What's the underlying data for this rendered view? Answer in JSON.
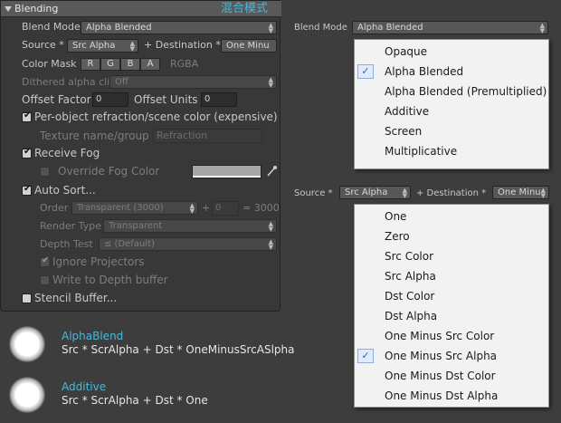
{
  "panel": {
    "title": "Blending",
    "chinese_title": "混合模式",
    "blend_mode": {
      "label": "Blend Mode",
      "value": "Alpha Blended"
    },
    "source": {
      "label": "Source *",
      "value": "Src Alpha"
    },
    "destination": {
      "label": "+ Destination *",
      "value": "One Minu"
    },
    "color_mask": {
      "label": "Color Mask",
      "channels": [
        "R",
        "G",
        "B",
        "A"
      ],
      "display": "RGBA"
    },
    "dithered": {
      "label": "Dithered alpha clip",
      "value": "Off"
    },
    "offset_factor": {
      "label": "Offset Factor",
      "value": "0"
    },
    "offset_units": {
      "label": "Offset Units",
      "value": "0"
    },
    "per_object_refraction": {
      "label": "Per-object refraction/scene color (expensive)",
      "checked": true
    },
    "texture_name": {
      "label": "Texture name/group",
      "value": "Refraction"
    },
    "receive_fog": {
      "label": "Receive Fog",
      "checked": true
    },
    "override_fog": {
      "label": "Override Fog Color",
      "checked": false
    },
    "auto_sort": {
      "label": "Auto Sort...",
      "checked": true
    },
    "order": {
      "label": "Order",
      "value": "Transparent (3000)",
      "plus": "+",
      "offset": "0",
      "result": "= 3000"
    },
    "render_type": {
      "label": "Render Type",
      "value": "Transparent"
    },
    "depth_test": {
      "label": "Depth Test",
      "value": "≤ (Default)"
    },
    "ignore_projectors": {
      "label": "Ignore Projectors",
      "checked": true
    },
    "write_depth": {
      "label": "Write to Depth buffer",
      "checked": false
    },
    "stencil": {
      "label": "Stencil Buffer...",
      "checked": false
    }
  },
  "right_blend": {
    "label": "Blend Mode",
    "value": "Alpha Blended"
  },
  "blend_menu": {
    "items": [
      "Opaque",
      "Alpha Blended",
      "Alpha Blended (Premultiplied)",
      "Additive",
      "Screen",
      "Multiplicative"
    ],
    "selected": 1
  },
  "right_source": {
    "label": "Source *",
    "value": "Src Alpha",
    "dest_label": "+ Destination *",
    "dest_value": "One Minu"
  },
  "factor_menu": {
    "items": [
      "One",
      "Zero",
      "Src Color",
      "Src Alpha",
      "Dst Color",
      "Dst Alpha",
      "One Minus Src Color",
      "One Minus Src Alpha",
      "One Minus Dst Color",
      "One Minus Dst Alpha"
    ],
    "selected": 7
  },
  "examples": [
    {
      "name": "AlphaBlend",
      "formula": "Src * ScrAlpha + Dst * OneMinusSrcASlpha"
    },
    {
      "name": "Additive",
      "formula": "Src * ScrAlpha + Dst * One"
    }
  ],
  "colors": {
    "accent_cyan": "#49b8d8",
    "panel_bg": "#383838",
    "menu_bg": "#f2f2f2",
    "check_blue": "#2b5fb8"
  }
}
